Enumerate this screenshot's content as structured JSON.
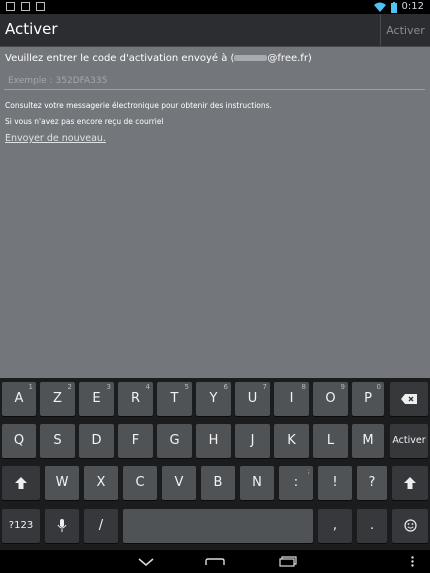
{
  "status_bar": {
    "time": "0:12"
  },
  "action_bar": {
    "title": "Activer",
    "action_label": "Activer"
  },
  "content": {
    "prompt_prefix": "Veuillez entrer le code d'activation envoyé à (",
    "prompt_suffix": "@free.fr)",
    "code_placeholder": "Exemple : 352DFA335",
    "code_value": "",
    "help_line_1": "Consultez votre messagerie électronique pour obtenir des instructions.",
    "help_line_2": "Si vous n'avez pas encore reçu de courriel",
    "resend_link": "Envoyer de nouveau."
  },
  "keyboard": {
    "row1": [
      {
        "label": "A",
        "hint": "1"
      },
      {
        "label": "Z",
        "hint": "2"
      },
      {
        "label": "E",
        "hint": "3"
      },
      {
        "label": "R",
        "hint": "4"
      },
      {
        "label": "T",
        "hint": "5"
      },
      {
        "label": "Y",
        "hint": "6"
      },
      {
        "label": "U",
        "hint": "7"
      },
      {
        "label": "I",
        "hint": "8"
      },
      {
        "label": "O",
        "hint": "9"
      },
      {
        "label": "P",
        "hint": "0"
      }
    ],
    "row2": [
      "Q",
      "S",
      "D",
      "F",
      "G",
      "H",
      "J",
      "K",
      "L",
      "M"
    ],
    "row3": [
      "W",
      "X",
      "C",
      "V",
      "B",
      "N",
      ":",
      "!",
      "?"
    ],
    "row3_hint_colon": ";",
    "enter_label": "Activer",
    "symbols_label": "?123",
    "slash_label": "/",
    "comma_label": ",",
    "period_label": ".",
    "icons": {
      "backspace": "backspace-icon",
      "shift": "shift-icon",
      "mic": "microphone-icon",
      "emoji": "emoji-icon"
    }
  },
  "nav_bar": {
    "icons": [
      "chevron-down-icon",
      "home-icon",
      "recent-apps-icon",
      "overflow-menu-icon"
    ]
  }
}
